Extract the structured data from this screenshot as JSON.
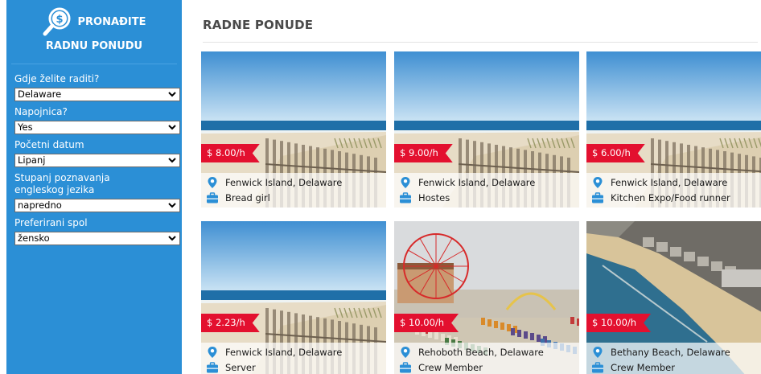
{
  "sidebar": {
    "brand_title": "PRONAĐITE",
    "brand_sub": "RADNU PONUDU",
    "filters": [
      {
        "label": "Gdje želite raditi?",
        "value": "Delaware"
      },
      {
        "label": "Napojnica?",
        "value": "Yes"
      },
      {
        "label": "Početni datum",
        "value": "Lipanj"
      },
      {
        "label": "Stupanj poznavanja engleskog jezika",
        "value": "napredno"
      },
      {
        "label": "Preferirani spol",
        "value": "žensko"
      }
    ]
  },
  "main": {
    "title": "RADNE PONUDE",
    "jobs": [
      {
        "price": "$ 8.00/h",
        "location": "Fenwick Island, Delaware",
        "position": "Bread girl",
        "scene": "beach"
      },
      {
        "price": "$ 9.00/h",
        "location": "Fenwick Island, Delaware",
        "position": "Hostes",
        "scene": "beach"
      },
      {
        "price": "$ 6.00/h",
        "location": "Fenwick Island, Delaware",
        "position": "Kitchen Expo/Food runner",
        "scene": "beach"
      },
      {
        "price": "$ 2.23/h",
        "location": "Fenwick Island, Delaware",
        "position": "Server",
        "scene": "beach"
      },
      {
        "price": "$ 10.00/h",
        "location": "Rehoboth Beach, Delaware",
        "position": "Crew Member",
        "scene": "boardwalk"
      },
      {
        "price": "$ 10.00/h",
        "location": "Bethany Beach, Delaware",
        "position": "Crew Member",
        "scene": "aerial"
      }
    ]
  },
  "colors": {
    "sidebar_bg": "#2b8fd6",
    "price_tag": "#e3102f",
    "icon_blue": "#2b8fd6"
  },
  "icons": {
    "brand": "search-dollar-icon",
    "location": "map-pin-icon",
    "position": "briefcase-icon",
    "select": "chevron-down-icon"
  }
}
